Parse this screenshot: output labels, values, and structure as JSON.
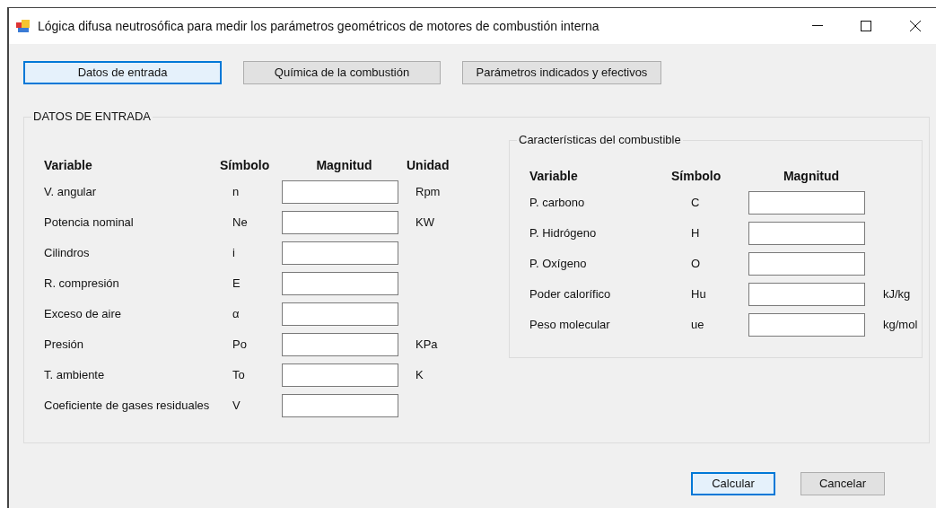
{
  "window": {
    "title": "Lógica difusa neutrosófica para medir los parámetros geométricos de motores de combustión interna"
  },
  "nav_buttons": [
    {
      "label": "Datos de entrada",
      "focused": true
    },
    {
      "label": "Química de la combustión",
      "focused": false
    },
    {
      "label": "Parámetros indicados y efectivos",
      "focused": false
    }
  ],
  "input_group": {
    "title": "DATOS DE ENTRADA",
    "columns": [
      "Variable",
      "Símbolo",
      "Magnitud",
      "Unidad"
    ],
    "rows": [
      {
        "variable": "V. angular",
        "symbol": "n",
        "unit": "Rpm"
      },
      {
        "variable": "Potencia nominal",
        "symbol": "Ne",
        "unit": "KW"
      },
      {
        "variable": "Cilindros",
        "symbol": "i"
      },
      {
        "variable": "R. compresión",
        "symbol": "E"
      },
      {
        "variable": "Exceso de aire",
        "symbol": "α"
      },
      {
        "variable": "Presión",
        "symbol": "Po",
        "unit": "KPa"
      },
      {
        "variable": "T. ambiente",
        "symbol": "To",
        "unit": "K"
      },
      {
        "variable": "Coeficiente de gases residuales",
        "symbol": "V"
      }
    ]
  },
  "fuel_group": {
    "title": "Características del combustible",
    "columns": [
      "Variable",
      "Símbolo",
      "Magnitud"
    ],
    "rows": [
      {
        "variable": "P. carbono",
        "symbol": "C"
      },
      {
        "variable": "P. Hidrógeno",
        "symbol": "H"
      },
      {
        "variable": "P. Oxígeno",
        "symbol": "O"
      },
      {
        "variable": "Poder calorífico",
        "symbol": "Hu",
        "unit": "kJ/kg"
      },
      {
        "variable": "Peso molecular",
        "symbol": "ue",
        "unit": "kg/mol"
      }
    ]
  },
  "action_buttons": [
    {
      "label": "Calcular",
      "focused": true
    },
    {
      "label": "Cancelar",
      "focused": false
    }
  ]
}
